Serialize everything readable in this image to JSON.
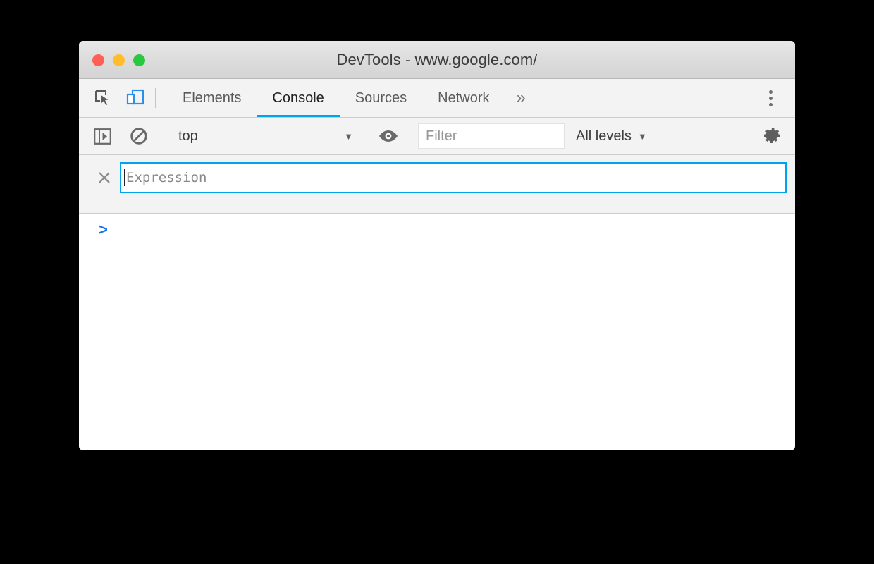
{
  "window": {
    "title": "DevTools - www.google.com/",
    "traffic_lights": [
      {
        "name": "close-button",
        "color": "#ff5f57"
      },
      {
        "name": "minimize-button",
        "color": "#ffbd2e"
      },
      {
        "name": "maximize-button",
        "color": "#28c840"
      }
    ]
  },
  "tabbar": {
    "inspect_icon": "inspect-element-icon",
    "device_icon": "device-toolbar-icon",
    "device_icon_color": "#2a8fec",
    "tabs": [
      {
        "label": "Elements",
        "active": false
      },
      {
        "label": "Console",
        "active": true
      },
      {
        "label": "Sources",
        "active": false
      },
      {
        "label": "Network",
        "active": false
      }
    ],
    "overflow_label": "»",
    "more_options_icon": "kebab-menu-icon",
    "active_underline_color": "#00a3ee"
  },
  "console_toolbar": {
    "sidebar_toggle_icon": "console-sidebar-toggle-icon",
    "clear_console_icon": "clear-console-icon",
    "context": "top",
    "context_caret": "▼",
    "live_expression_icon": "eye-icon",
    "filter": {
      "value": "",
      "placeholder": "Filter"
    },
    "log_levels": {
      "label": "All levels",
      "caret": "▼"
    },
    "settings_icon": "gear-icon"
  },
  "live_expression": {
    "close_icon": "×",
    "input": {
      "value": "",
      "placeholder": "Expression",
      "focused": true,
      "border_color": "#00a3ee"
    }
  },
  "console_output": {
    "prompt": ">",
    "prompt_color": "#1a73e8",
    "messages": []
  }
}
